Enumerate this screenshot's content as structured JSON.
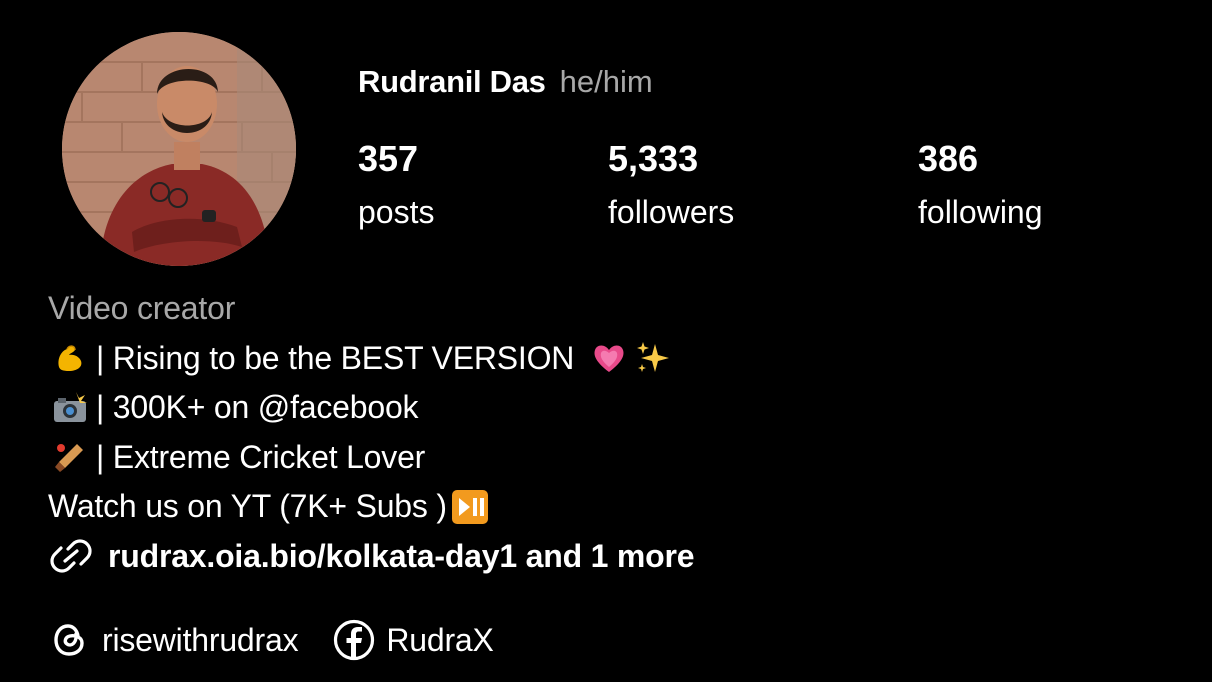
{
  "profile": {
    "display_name": "Rudranil Das",
    "pronouns": "he/him",
    "avatar_icon": "profile-photo"
  },
  "stats": {
    "posts": {
      "count": "357",
      "label": "posts"
    },
    "followers": {
      "count": "5,333",
      "label": "followers"
    },
    "following": {
      "count": "386",
      "label": "following"
    }
  },
  "bio": {
    "category": "Video creator",
    "lines": [
      {
        "icon": "flexed-biceps-emoji",
        "text": "| Rising to be the BEST VERSION",
        "trailing_icons": [
          "growing-heart-emoji",
          "sparkles-emoji"
        ]
      },
      {
        "icon": "camera-flash-emoji",
        "text": "| 300K+ on @facebook"
      },
      {
        "icon": "cricket-bat-emoji",
        "text": "| Extreme Cricket Lover"
      },
      {
        "text": "Watch us on YT (7K+ Subs )",
        "trailing_icons": [
          "play-pause-button-emoji"
        ]
      }
    ],
    "link": {
      "icon": "link-icon",
      "text": "rudrax.oia.bio/kolkata-day1 and 1 more"
    }
  },
  "social": [
    {
      "icon": "threads-icon",
      "label": "risewithrudrax"
    },
    {
      "icon": "facebook-icon",
      "label": "RudraX"
    }
  ],
  "colors": {
    "background": "#000000",
    "text_primary": "#ffffff",
    "text_secondary": "#a8a8a8"
  }
}
